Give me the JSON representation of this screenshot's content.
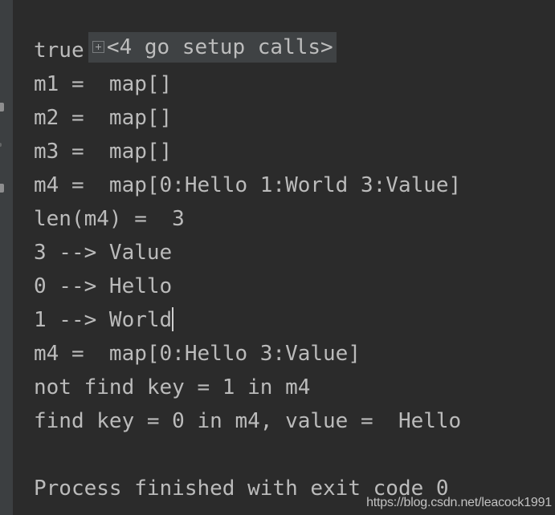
{
  "app": {
    "theme": "darcula",
    "background_color": "#2b2b2b",
    "gutter_color": "#3c3f41",
    "highlight_color": "#3f4244",
    "text_color": "#bbbbbb"
  },
  "gutter": {
    "icons": [
      {
        "name": "run-icon"
      },
      {
        "name": "rerun-icon"
      },
      {
        "name": "stop-icon"
      }
    ]
  },
  "console": {
    "fold": {
      "icon": "expand-plus-icon",
      "label": "<4 go setup calls>",
      "expanded": false
    },
    "lines": [
      {
        "id": 1,
        "text": "true"
      },
      {
        "id": 2,
        "text": "m1 =  map[]"
      },
      {
        "id": 3,
        "text": "m2 =  map[]"
      },
      {
        "id": 4,
        "text": "m3 =  map[]"
      },
      {
        "id": 5,
        "text": "m4 =  map[0:Hello 1:World 3:Value]"
      },
      {
        "id": 6,
        "text": "len(m4) =  3"
      },
      {
        "id": 7,
        "text": "3 --> Value"
      },
      {
        "id": 8,
        "text": "0 --> Hello"
      },
      {
        "id": 9,
        "text": "1 --> World"
      },
      {
        "id": 10,
        "text": "m4 =  map[0:Hello 3:Value]"
      },
      {
        "id": 11,
        "text": "not find key = 1 in m4"
      },
      {
        "id": 12,
        "text": "find key = 0 in m4, value =  Hello"
      },
      {
        "id": 13,
        "text": ""
      },
      {
        "id": 14,
        "text": "Process finished with exit code 0"
      }
    ]
  },
  "watermark": {
    "text": "https://blog.csdn.net/leacock1991"
  }
}
